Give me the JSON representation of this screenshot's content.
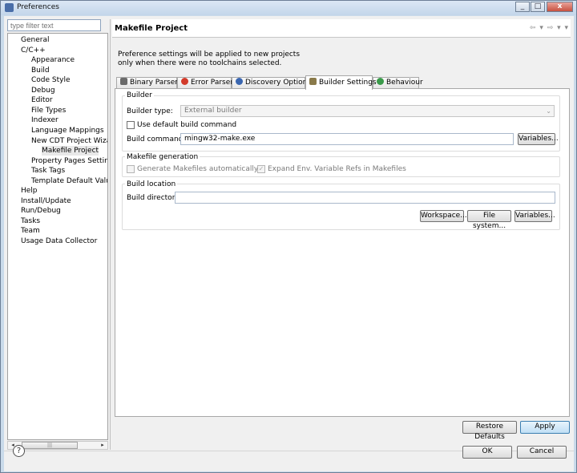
{
  "window": {
    "title": "Preferences",
    "buttons": [
      "_",
      "□",
      "x"
    ]
  },
  "filter": {
    "placeholder": "type filter text"
  },
  "tree": [
    {
      "label": "General",
      "indent": 0
    },
    {
      "label": "C/C++",
      "indent": 0
    },
    {
      "label": "Appearance",
      "indent": 1
    },
    {
      "label": "Build",
      "indent": 1
    },
    {
      "label": "Code Style",
      "indent": 1
    },
    {
      "label": "Debug",
      "indent": 1
    },
    {
      "label": "Editor",
      "indent": 1
    },
    {
      "label": "File Types",
      "indent": 1
    },
    {
      "label": "Indexer",
      "indent": 1
    },
    {
      "label": "Language Mappings",
      "indent": 1
    },
    {
      "label": "New CDT Project Wiza",
      "indent": 1
    },
    {
      "label": "Makefile Project",
      "indent": 2,
      "selected": true
    },
    {
      "label": "Property Pages Setting",
      "indent": 1
    },
    {
      "label": "Task Tags",
      "indent": 1
    },
    {
      "label": "Template Default Value",
      "indent": 1
    },
    {
      "label": "Help",
      "indent": 0
    },
    {
      "label": "Install/Update",
      "indent": 0
    },
    {
      "label": "Run/Debug",
      "indent": 0
    },
    {
      "label": "Tasks",
      "indent": 0
    },
    {
      "label": "Team",
      "indent": 0
    },
    {
      "label": "Usage Data Collector",
      "indent": 0
    }
  ],
  "page": {
    "title": "Makefile Project",
    "nav": "⇦ ▾ ⇨ ▾ ▾",
    "description": [
      "Preference settings will be applied to new projects",
      "only when there were no toolchains selected."
    ]
  },
  "tabs": [
    {
      "label": "Binary Parsers",
      "icon": "binary-parser-icon",
      "color": "#6b6b6b"
    },
    {
      "label": "Error Parsers",
      "icon": "error-icon",
      "color": "#d23a2a"
    },
    {
      "label": "Discovery Options",
      "icon": "discovery-icon",
      "color": "#3a66b0"
    },
    {
      "label": "Builder Settings",
      "icon": "builder-icon",
      "color": "#8a7a4a",
      "active": true
    },
    {
      "label": "Behaviour",
      "icon": "behaviour-icon",
      "color": "#3a9a4a"
    }
  ],
  "builder": {
    "group_label": "Builder",
    "type_label": "Builder type:",
    "type_value": "External builder",
    "use_default_label": "Use default build command",
    "use_default_checked": false,
    "command_label": "Build command:",
    "command_value": "mingw32-make.exe",
    "variables_button": "Variables..."
  },
  "makefile_gen": {
    "group_label": "Makefile generation",
    "generate_label": "Generate Makefiles automatically",
    "generate_checked": false,
    "expand_label": "Expand Env. Variable Refs in Makefiles",
    "expand_checked": true
  },
  "build_location": {
    "group_label": "Build location",
    "directory_label": "Build directory:",
    "directory_value": "",
    "workspace_button": "Workspace...",
    "filesystem_button": "File system...",
    "variables_button": "Variables..."
  },
  "footer": {
    "restore_defaults": "Restore Defaults",
    "apply": "Apply",
    "ok": "OK",
    "cancel": "Cancel",
    "help": "?"
  }
}
